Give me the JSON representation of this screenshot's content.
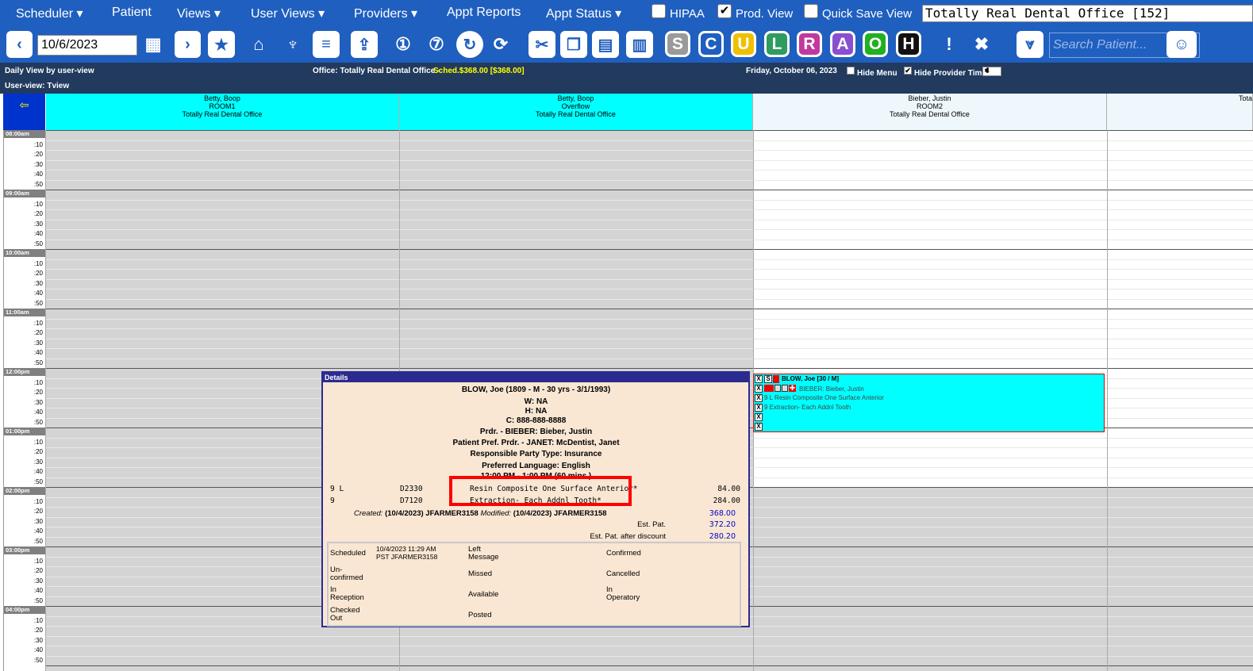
{
  "menu": {
    "scheduler": "Scheduler ▾",
    "patient": "Patient",
    "views": "Views ▾",
    "user_views": "User Views ▾",
    "providers": "Providers ▾",
    "appt_reports": "Appt Reports",
    "appt_status": "Appt Status ▾",
    "hipaa": "HIPAA",
    "prod_view": "Prod. View",
    "quick_save": "Quick Save View",
    "office": "Totally Real Dental Office [152]"
  },
  "toolbar": {
    "date": "10/6/2023",
    "search_placeholder": "Search Patient...",
    "letters": [
      "S",
      "C",
      "U",
      "L",
      "R",
      "A",
      "O",
      "H"
    ],
    "letter_colors": [
      "#9a9a9a",
      "#1f5fbf",
      "#f0c000",
      "#2e9b5f",
      "#c0399e",
      "#8a4fd0",
      "#20b020",
      "#111111"
    ]
  },
  "infobar": {
    "view": "Daily View by user-view",
    "office_label": "Office: Totally Real Dental Office - ",
    "sched": "Sched.$368.00 [$368.00]",
    "date": "Friday, October 06, 2023",
    "hide_menu": "Hide Menu",
    "hide_provider_time": "Hide Provider Time",
    "interval": "4",
    "userview": "User-view: Tview"
  },
  "columns": [
    {
      "l1": "Betty, Boop",
      "l2": "ROOM1",
      "l3": "Totally Real Dental Office"
    },
    {
      "l1": "Betty, Boop",
      "l2": "Overflow",
      "l3": "Totally Real Dental Office"
    },
    {
      "l1": "Bieber, Justin",
      "l2": "ROOM2",
      "l3": "Totally Real Dental Office"
    },
    {
      "l1": "",
      "l2": "",
      "l3": "Tota"
    }
  ],
  "times": [
    "08:00am",
    "09:00am",
    "10:00am",
    "11:00am",
    "12:00pm",
    "01:00pm",
    "02:00pm",
    "03:00pm",
    "04:00pm"
  ],
  "minutes": [
    ":10",
    ":20",
    ":30",
    ":40",
    ":50"
  ],
  "appt": {
    "name": "BLOW, Joe [30 / M]",
    "provider": "BIEBER: Bieber, Justin",
    "proc1": "9 L Resin Composite One Surface Anterior",
    "proc2": "9 Extraction- Each Addnl Tooth",
    "x": "X"
  },
  "details": {
    "title": "Details",
    "patient": "BLOW, Joe (1809 - M - 30 yrs - 3/1/1993)",
    "work": "W: NA",
    "home": "H: NA",
    "cell": "C: 888-888-8888",
    "prdr": "Prdr. - BIEBER: Bieber, Justin",
    "pref_prdr": "Patient Pref. Prdr. - JANET: McDentist, Janet",
    "resp": "Responsible Party Type: Insurance",
    "lang": "Preferred Language: English",
    "time": "12:00 PM - 1:00 PM (60 mins.)",
    "procedures": [
      {
        "tooth": "9 L",
        "code": "D2330",
        "desc": "Resin Composite One Surface Anterior*",
        "fee": "84.00"
      },
      {
        "tooth": "9",
        "code": "D7120",
        "desc": "Extraction- Each Addnl Tooth*",
        "fee": "284.00"
      }
    ],
    "created_lbl": "Created:",
    "created": "(10/4/2023) JFARMER3158",
    "modified_lbl": "Modified:",
    "modified": "(10/4/2023) JFARMER3158",
    "total": "368.00",
    "est_pat_lbl": "Est. Pat.",
    "est_pat": "372.20",
    "est_disc_lbl": "Est. Pat. after discount",
    "est_disc": "280.20",
    "status": {
      "scheduled": "Scheduled",
      "sched_time": "10/4/2023 11:29 AM",
      "sched_user": "PST JFARMER3158",
      "left1": "Left",
      "left2": "Message",
      "confirmed": "Confirmed",
      "unc1": "Un-",
      "unc2": "confirmed",
      "missed": "Missed",
      "cancelled": "Cancelled",
      "inr1": "In",
      "inr2": "Reception",
      "available": "Available",
      "ino1": "In",
      "ino2": "Operatory",
      "chk1": "Checked",
      "chk2": "Out",
      "posted": "Posted"
    }
  }
}
